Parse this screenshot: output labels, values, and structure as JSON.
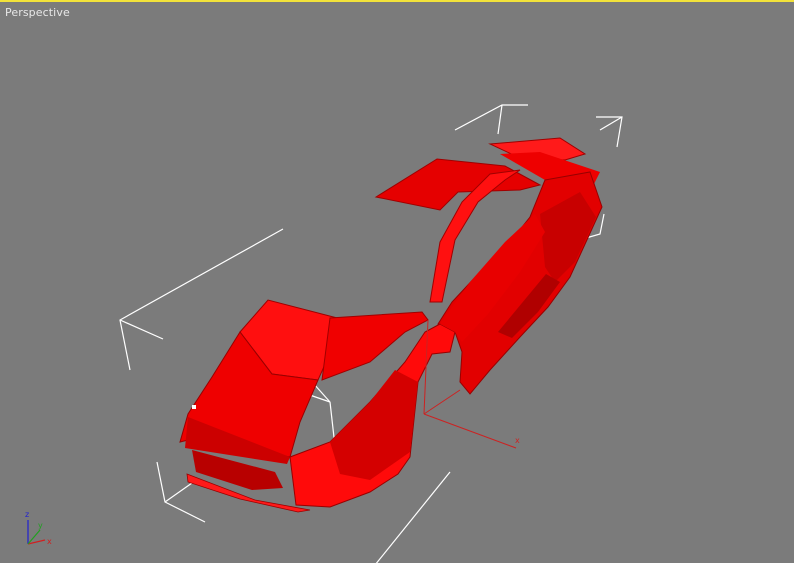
{
  "viewport": {
    "label": "Perspective",
    "active_border_color": "#f2e23a",
    "background_color": "#7b7b7b"
  },
  "scene": {
    "object": "car-body",
    "object_color": "#ff0000",
    "bounding_box_color": "#ffffff",
    "pivot_axis_color": "#cc2222"
  },
  "pivot_axis": {
    "x_label": "x"
  },
  "axis_gizmo": {
    "x_label": "x",
    "y_label": "y",
    "z_label": "z"
  }
}
